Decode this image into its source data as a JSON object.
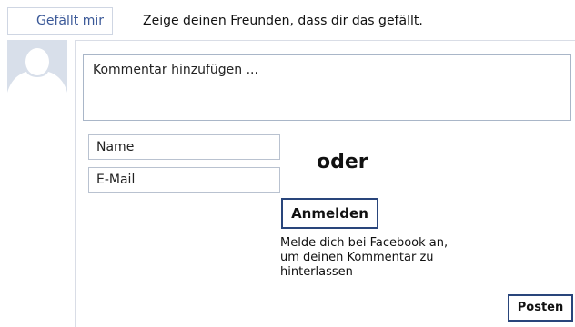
{
  "like": {
    "button_label": "Gefällt mir",
    "prompt": "Zeige deinen Freunden, dass dir das gefällt."
  },
  "comment": {
    "placeholder": "Kommentar hinzufügen ..."
  },
  "guest_form": {
    "name_placeholder": "Name",
    "email_placeholder": "E-Mail",
    "or_label": "oder"
  },
  "login": {
    "button_label": "Anmelden",
    "hint_lines": [
      "Melde dich bei Facebook an,",
      "um deinen Kommentar zu",
      "hinterlassen"
    ]
  },
  "actions": {
    "post_label": "Posten"
  },
  "icons": {
    "avatar": "default-user-silhouette-icon"
  },
  "colors": {
    "link_blue": "#3b5998",
    "button_border": "#29457b",
    "avatar_bg": "#d8dfea",
    "silhouette": "#ffffff"
  }
}
